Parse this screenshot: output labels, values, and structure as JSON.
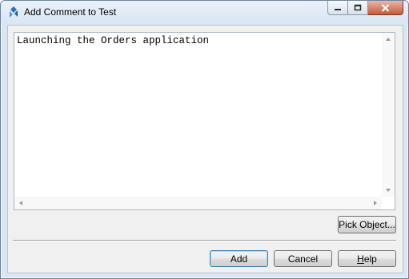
{
  "window": {
    "title": "Add Comment to Test"
  },
  "editor": {
    "text": "Launching the Orders application"
  },
  "buttons": {
    "pick_object": "Pick Object...",
    "add": "Add",
    "cancel": "Cancel",
    "help_mnemonic": "H",
    "help_rest": "elp"
  },
  "icons": {
    "app": "testcomplete-app-icon",
    "minimize": "minimize-icon",
    "maximize": "maximize-icon",
    "close": "close-icon"
  }
}
